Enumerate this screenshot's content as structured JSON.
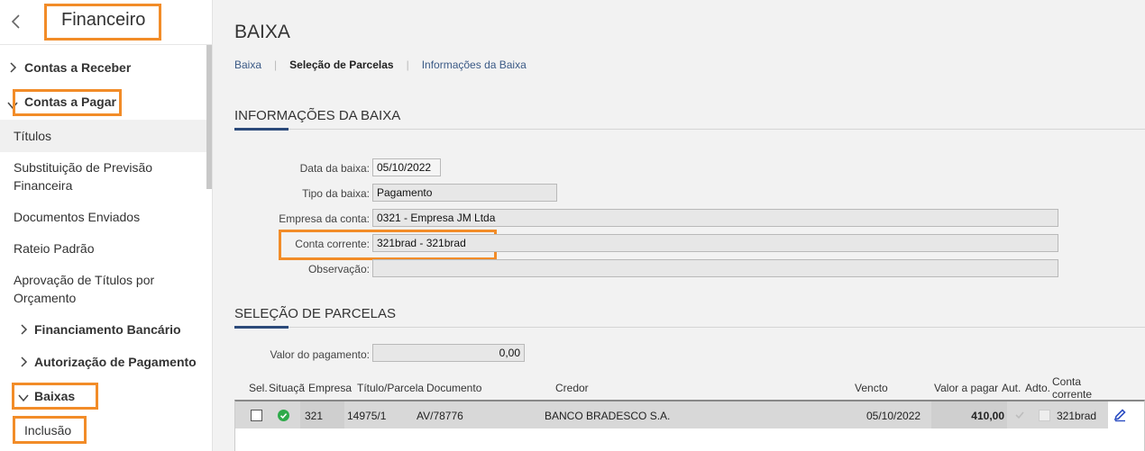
{
  "sidebar": {
    "title": "Financeiro",
    "items": [
      {
        "label": "Contas a Receber"
      },
      {
        "label": "Contas a Pagar"
      },
      {
        "label": "Títulos"
      },
      {
        "label": "Substituição de Previsão"
      },
      {
        "label": "Financeira"
      },
      {
        "label": "Documentos Enviados"
      },
      {
        "label": "Rateio Padrão"
      },
      {
        "label": "Aprovação de Títulos por"
      },
      {
        "label": "Orçamento"
      },
      {
        "label": "Financiamento Bancário"
      },
      {
        "label": "Autorização de Pagamento"
      },
      {
        "label": "Baixas"
      },
      {
        "label": "Inclusão"
      }
    ]
  },
  "page": {
    "title": "BAIXA",
    "breadcrumb": [
      "Baixa",
      "Seleção de Parcelas",
      "Informações da Baixa"
    ]
  },
  "info": {
    "section_title": "INFORMAÇÕES DA BAIXA",
    "data_label": "Data da baixa:",
    "data_value": "05/10/2022",
    "tipo_label": "Tipo da baixa:",
    "tipo_value": "Pagamento",
    "empresa_label": "Empresa da conta:",
    "empresa_value": "0321 - Empresa JM Ltda",
    "conta_label": "Conta corrente:",
    "conta_value": "321brad - 321brad",
    "obs_label": "Observação:",
    "obs_value": ""
  },
  "selecao": {
    "section_title": "SELEÇÃO DE PARCELAS",
    "valor_label": "Valor do pagamento:",
    "valor_value": "0,00",
    "columns": [
      "Sel.",
      "Situaçã",
      "Empresa",
      "Título/Parcela",
      "Documento",
      "Credor",
      "Vencto",
      "Valor a pagar",
      "Aut.",
      "Adto.",
      "Conta",
      "corrente"
    ],
    "rows": [
      {
        "empresa": "321",
        "titulo": "14975/1",
        "documento": "AV/78776",
        "credor": "BANCO BRADESCO S.A.",
        "vencto": "05/10/2022",
        "valor": "410,00",
        "conta": "321brad"
      }
    ]
  },
  "colors": {
    "highlight": "#f28c28",
    "accent": "#2c4a7a",
    "status_ok": "#2eaa4a"
  }
}
